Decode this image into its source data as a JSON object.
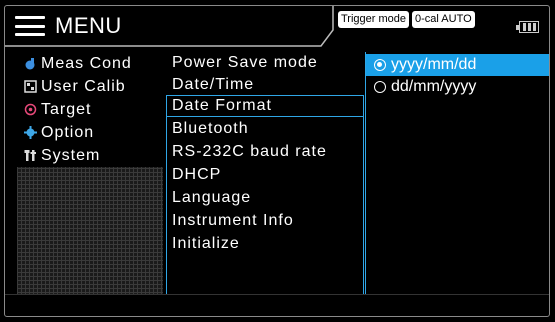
{
  "header": {
    "menu_label": "MENU",
    "status": [
      "Trigger mode",
      "0-cal AUTO"
    ]
  },
  "categories": [
    {
      "label": "Meas Cond",
      "icon": "meas-cond-icon"
    },
    {
      "label": "User Calib",
      "icon": "user-calib-icon"
    },
    {
      "label": "Target",
      "icon": "target-icon"
    },
    {
      "label": "Option",
      "icon": "option-gear-icon"
    },
    {
      "label": "System",
      "icon": "system-tools-icon"
    }
  ],
  "system_items": [
    "Power Save mode",
    "Date/Time",
    "Date Format",
    "Bluetooth",
    "RS-232C baud rate",
    "DHCP",
    "Language",
    "Instrument Info",
    "Initialize"
  ],
  "date_format_options": [
    {
      "label": "yyyy/mm/dd",
      "selected": true
    },
    {
      "label": "dd/mm/yyyy",
      "selected": false
    }
  ],
  "colors": {
    "accent": "#1aa0e8",
    "meas_cond_icon": "#3c8fe0",
    "target_icon": "#e8497a",
    "option_icon": "#3ea8e8"
  }
}
